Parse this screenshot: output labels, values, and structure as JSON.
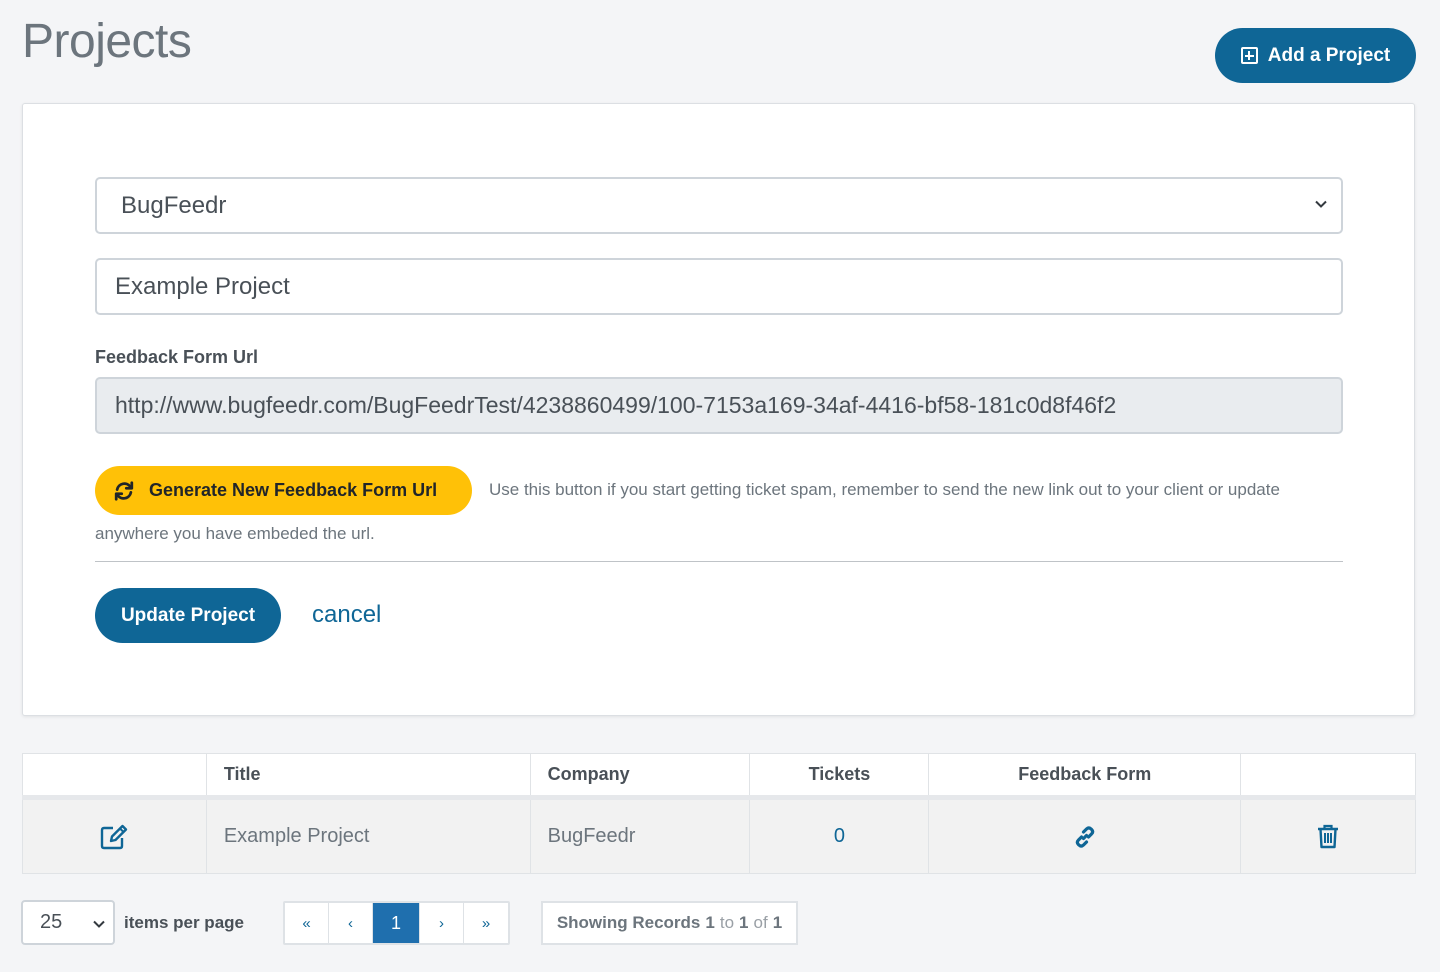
{
  "header": {
    "title": "Projects",
    "add_button": "Add a Project"
  },
  "form": {
    "company_selected": "BugFeedr",
    "project_title": "Example Project",
    "url_label": "Feedback Form Url",
    "url_value": "http://www.bugfeedr.com/BugFeedrTest/4238860499/100-7153a169-34af-4416-bf58-181c0d8f46f2",
    "generate_button": "Generate New Feedback Form Url",
    "generate_help_line1": "Use this button if you start getting ticket spam, remember to send the new link out to your client or update",
    "generate_help_line2": "anywhere you have embeded the url.",
    "update_button": "Update Project",
    "cancel_link": "cancel"
  },
  "table": {
    "columns": [
      "",
      "Title",
      "Company",
      "Tickets",
      "Feedback Form",
      ""
    ],
    "rows": [
      {
        "title": "Example Project",
        "company": "BugFeedr",
        "tickets": "0"
      }
    ]
  },
  "pagination": {
    "per_page": "25",
    "per_page_label": "items per page",
    "first": "«",
    "prev": "‹",
    "current": "1",
    "next": "›",
    "last": "»",
    "records": {
      "prefix": "Showing Records",
      "from": "1",
      "to_word": "to",
      "to": "1",
      "of_word": "of",
      "total": "1"
    }
  },
  "colors": {
    "primary": "#0f6696",
    "warning": "#ffc107",
    "pager_active": "#1f6fae"
  },
  "icons": [
    "plus-square-icon",
    "chevron-down-icon",
    "refresh-icon",
    "edit-icon",
    "link-icon",
    "trash-icon"
  ]
}
